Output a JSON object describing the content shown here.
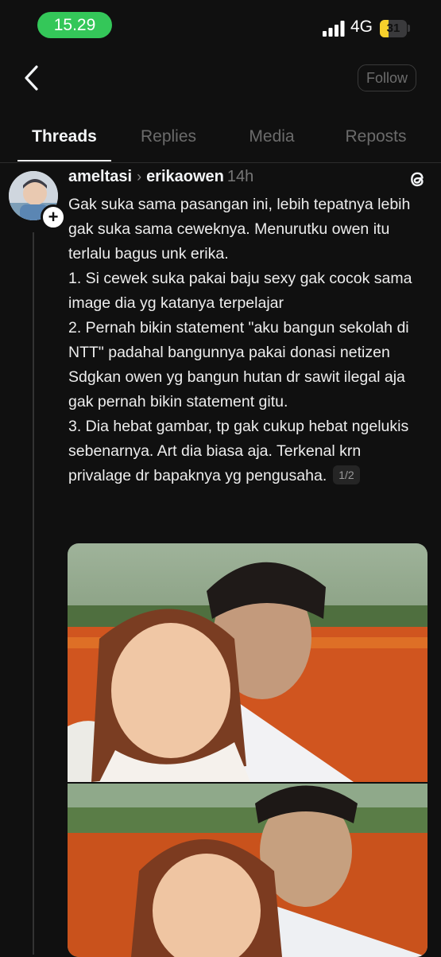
{
  "status_bar": {
    "time": "15.29",
    "network": "4G",
    "battery_level": "31",
    "colors": {
      "time_pill": "#34c759",
      "battery": "#f7d02c"
    },
    "icons": [
      "signal-icon",
      "battery-icon"
    ]
  },
  "header": {
    "back_icon": "chevron-left-icon",
    "follow_label": "Follow"
  },
  "tabs": [
    {
      "label": "Threads",
      "active": true
    },
    {
      "label": "Replies",
      "active": false
    },
    {
      "label": "Media",
      "active": false
    },
    {
      "label": "Reposts",
      "active": false
    }
  ],
  "post": {
    "username": "ameltasi",
    "reply_to": "erikaowen",
    "time": "14h",
    "threads_icon": "threads-logo-icon",
    "lines": [
      "Gak suka sama pasangan ini, lebih tepatnya lebih gak suka sama ceweknya. Menurutku owen itu terlalu bagus unk erika.",
      "1. Si cewek suka pakai baju sexy gak cocok sama image dia yg katanya terpelajar",
      "2. Pernah bikin statement \"aku bangun sekolah di NTT\" padahal bangunnya pakai donasi netizen",
      "Sdgkan owen yg bangun hutan dr sawit ilegal aja gak pernah bikin statement gitu.",
      "3. Dia hebat gambar, tp gak cukup hebat ngelukis sebenarnya. Art dia biasa aja. Terkenal krn privalage dr bapaknya yg pengusaha."
    ],
    "page_indicator": "1/2",
    "media_alt": "photo"
  }
}
